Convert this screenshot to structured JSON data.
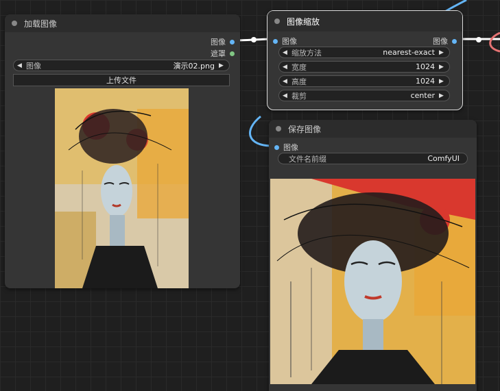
{
  "load_node": {
    "title": "加载图像",
    "outputs": [
      "图像",
      "遮罩"
    ],
    "image_widget": {
      "label": "图像",
      "value": "演示02.png"
    },
    "upload_label": "上传文件"
  },
  "resize_node": {
    "title": "图像缩放",
    "input": "图像",
    "output": "图像",
    "widgets": [
      {
        "label": "缩放方法",
        "value": "nearest-exact"
      },
      {
        "label": "宽度",
        "value": "1024"
      },
      {
        "label": "高度",
        "value": "1024"
      },
      {
        "label": "裁剪",
        "value": "center"
      }
    ]
  },
  "save_node": {
    "title": "保存图像",
    "input": "图像",
    "prefix_widget": {
      "label": "文件名前缀",
      "value": "ComfyUI"
    }
  },
  "colors": {
    "image_slot": "#64b5f6",
    "mask_slot": "#81c784",
    "link_image": "#64b5f6",
    "link_other": "#e57373"
  }
}
